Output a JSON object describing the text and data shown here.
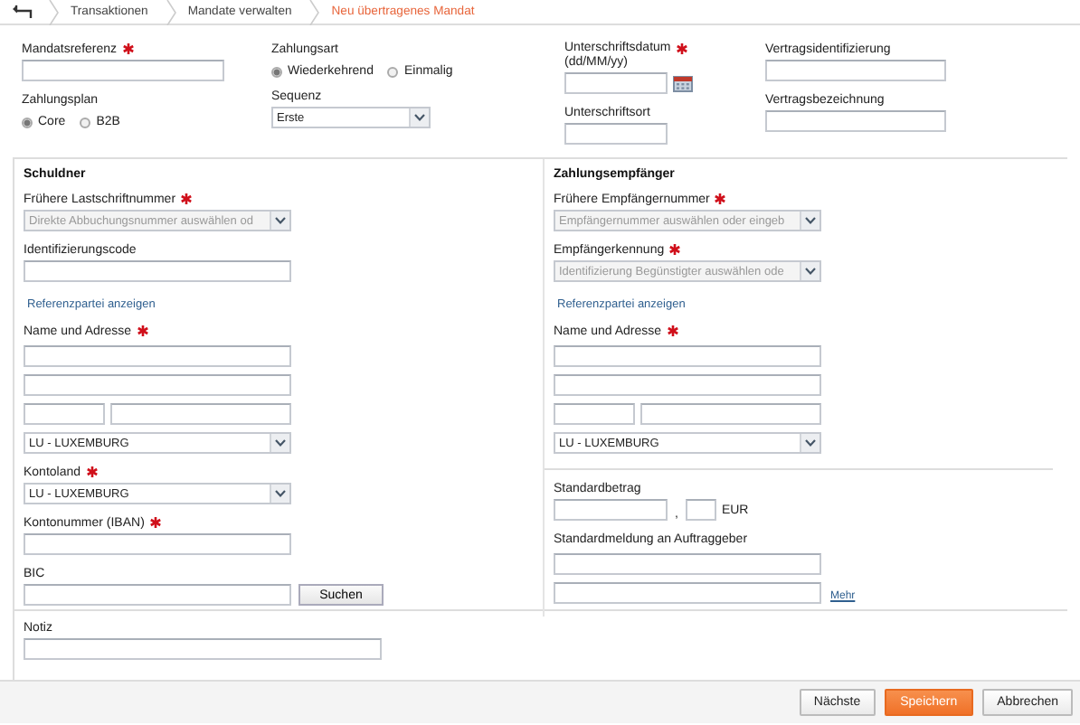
{
  "breadcrumb": {
    "items": [
      {
        "label": "Transaktionen",
        "selected": false
      },
      {
        "label": "Mandate verwalten",
        "selected": false
      },
      {
        "label": "Neu übertragenes Mandat",
        "selected": true
      }
    ]
  },
  "mandate": {
    "columns": [
      {
        "items": [
          {
            "kind": "input",
            "label": "Mandatsreferenz",
            "required": true
          },
          {
            "kind": "radio",
            "label": "Zahlungsplan",
            "options": [
              {
                "label": "Core",
                "selected": true
              },
              {
                "label": "B2B",
                "selected": false
              }
            ]
          }
        ]
      },
      {
        "items": [
          {
            "kind": "radio",
            "label": "Zahlungsart",
            "options": [
              {
                "label": "Wiederkehrend",
                "selected": true
              },
              {
                "label": "Einmalig",
                "selected": false
              }
            ]
          },
          {
            "kind": "select",
            "label": "Sequenz",
            "value": "Erste"
          }
        ]
      },
      {
        "items": [
          {
            "kind": "date",
            "label": "Unterschriftsdatum (dd/MM/yy)",
            "required": true
          },
          {
            "kind": "input",
            "label": "Unterschriftsort"
          }
        ]
      },
      {
        "items": [
          {
            "kind": "input",
            "label": "Vertragsidentifizierung"
          },
          {
            "kind": "input",
            "label": "Vertragsbezeichnung"
          }
        ]
      }
    ]
  },
  "debtor": {
    "title": "Schuldner",
    "items": [
      {
        "kind": "select",
        "label": "Frühere Lastschriftnummer",
        "required": true,
        "placeholder": "Direkte Abbuchungsnummer auswählen od"
      },
      {
        "kind": "input",
        "label": "Identifizierungscode"
      },
      {
        "kind": "link",
        "label": "Referenzpartei anzeigen"
      },
      {
        "kind": "address",
        "label": "Name und Adresse",
        "required": true,
        "country": "LU - LUXEMBURG"
      },
      {
        "kind": "select",
        "label": "Kontoland",
        "required": true,
        "value": "LU - LUXEMBURG"
      },
      {
        "kind": "input",
        "label": "Kontonummer (IBAN)",
        "required": true
      },
      {
        "kind": "search",
        "label": "BIC",
        "button": "Suchen"
      }
    ]
  },
  "payee": {
    "title": "Zahlungsempfänger",
    "items": [
      {
        "kind": "select",
        "label": "Frühere Empfängernummer",
        "required": true,
        "placeholder": "Empfängernummer auswählen oder eingeb"
      },
      {
        "kind": "select",
        "label": "Empfängerkennung",
        "required": true,
        "placeholder": "Identifizierung Begünstigter auswählen ode"
      },
      {
        "kind": "link",
        "label": "Referenzpartei anzeigen"
      },
      {
        "kind": "address",
        "label": "Name und Adresse",
        "required": true,
        "country": "LU - LUXEMBURG"
      }
    ]
  },
  "defaults": {
    "items": [
      {
        "kind": "amount",
        "label": "Standardbetrag",
        "separator": ",",
        "currency": "EUR"
      },
      {
        "kind": "more",
        "label": "Standardmeldung an Auftraggeber",
        "link": "Mehr"
      }
    ]
  },
  "note": {
    "items": [
      {
        "kind": "input",
        "label": "Notiz"
      }
    ]
  },
  "footer": {
    "buttons": [
      {
        "label": "Nächste",
        "kind": "default"
      },
      {
        "label": "Speichern",
        "kind": "primary"
      },
      {
        "label": "Abbrechen",
        "kind": "default"
      }
    ]
  }
}
